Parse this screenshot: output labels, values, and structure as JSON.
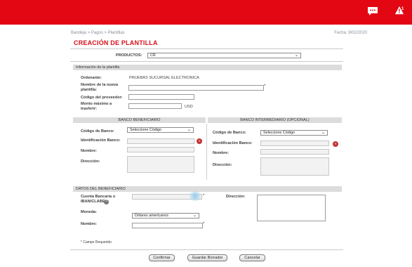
{
  "header": {
    "chat_icon": "chat-bubble-icon",
    "alert_icon": "warning-icon",
    "alert_badge": "1"
  },
  "breadcrumb": "Bandeja > Pagos > Plantillas",
  "date": "Fecha: 9/02/2020",
  "title": "CREACIÓN DE PLANTILLA",
  "productos": {
    "label": "PRODUCTOS:",
    "value": "CR"
  },
  "info_section": {
    "header": "Información de la plantilla",
    "ordenante_label": "Ordenante:",
    "ordenante_value": "PRUEBAS SUCURSAL ELECTRONICA",
    "nombre_label": "Nombre de la nueva plantilla:",
    "codigo_label": "Código del proveedor:",
    "monto_label": "Monto máximo a trasferir:",
    "currency": "USD"
  },
  "banco_beneficiario": {
    "header": "BANCO BENEFICIARIO",
    "codigo_label": "Código de Banco:",
    "codigo_value": "Seleccione Código",
    "ident_label": "Identificación Banco:",
    "nombre_label": "Nombre:",
    "direccion_label": "Dirección:"
  },
  "banco_intermediario": {
    "header": "BANCO INTERMEDIARIO (OPCIONAL)",
    "codigo_label": "Código de Banco:",
    "codigo_value": "Seleccione Código",
    "ident_label": "Identificación Banco:",
    "nombre_label": "Nombre:",
    "direccion_label": "Dirección:"
  },
  "datos_beneficiario": {
    "header": "DATOS DEL BENEFICIARIO",
    "cuenta_label": "Cuenta Bancaria o IBAN/CLABE",
    "direccion_label": "Dirección:",
    "moneda_label": "Moneda:",
    "moneda_value": "Dólares americanos",
    "nombre_label": "Nombre:"
  },
  "required_note": "* Campo Requerido",
  "required_mark": "*",
  "buttons": {
    "confirm": "Confirmar",
    "draft": "Guardar Borrador",
    "cancel": "Cancelar"
  }
}
